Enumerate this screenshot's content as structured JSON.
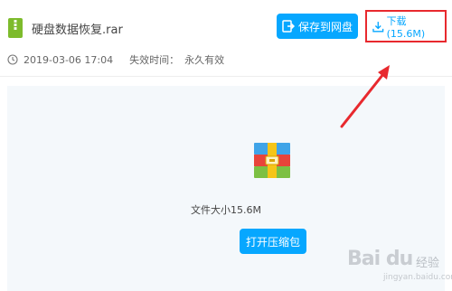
{
  "file": {
    "name": "硬盘数据恢复.rar",
    "date": "2019-03-06 17:04",
    "expiry_label": "失效时间：",
    "expiry_value": "永久有效"
  },
  "toolbar": {
    "save_label": "保存到网盘",
    "download_label": "下载(15.6M)"
  },
  "preview": {
    "size_label": "文件大小15.6M",
    "open_label": "打开压缩包"
  },
  "watermark": {
    "logo": "Bai du",
    "suffix": "经验",
    "url": "jingyan.baidu.com"
  },
  "colors": {
    "accent": "#06a7ff",
    "highlight": "#e8292e",
    "panel": "#f4f8fb"
  }
}
